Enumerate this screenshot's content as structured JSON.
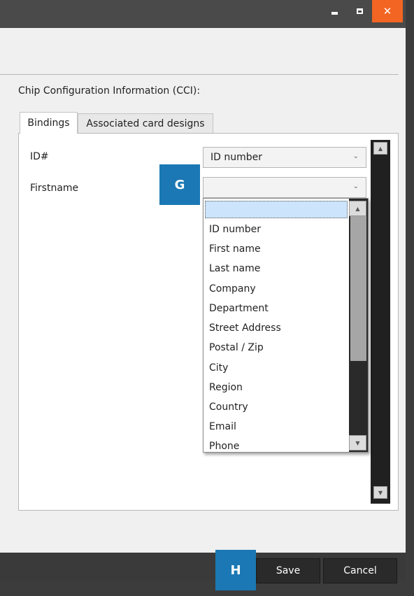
{
  "window": {
    "controls": {
      "minimize": "minimize",
      "maximize": "maximize",
      "close_symbol": "✕"
    }
  },
  "section": {
    "label": "Chip Configuration Information (CCI):"
  },
  "tabs": [
    {
      "label": "Bindings",
      "active": true
    },
    {
      "label": "Associated card designs",
      "active": false
    }
  ],
  "bindings": [
    {
      "label": "ID#",
      "value": "ID number"
    },
    {
      "label": "Firstname",
      "value": ""
    }
  ],
  "dropdown": {
    "selected_index": 0,
    "options": [
      "",
      "ID number",
      "First name",
      "Last name",
      "Company",
      "Department",
      "Street Address",
      "Postal / Zip",
      "City",
      "Region",
      "Country",
      "Email",
      "Phone"
    ]
  },
  "callouts": {
    "g": "G",
    "h": "H"
  },
  "footer": {
    "save_label": "Save",
    "cancel_label": "Cancel"
  },
  "icons": {
    "chevron": "chevron-down-icon",
    "scroll_up": "scroll-up-arrow-icon",
    "scroll_down": "scroll-down-arrow-icon"
  },
  "colors": {
    "accent_close": "#f26522",
    "callout": "#1b78b4",
    "selection": "#cce4fc"
  }
}
